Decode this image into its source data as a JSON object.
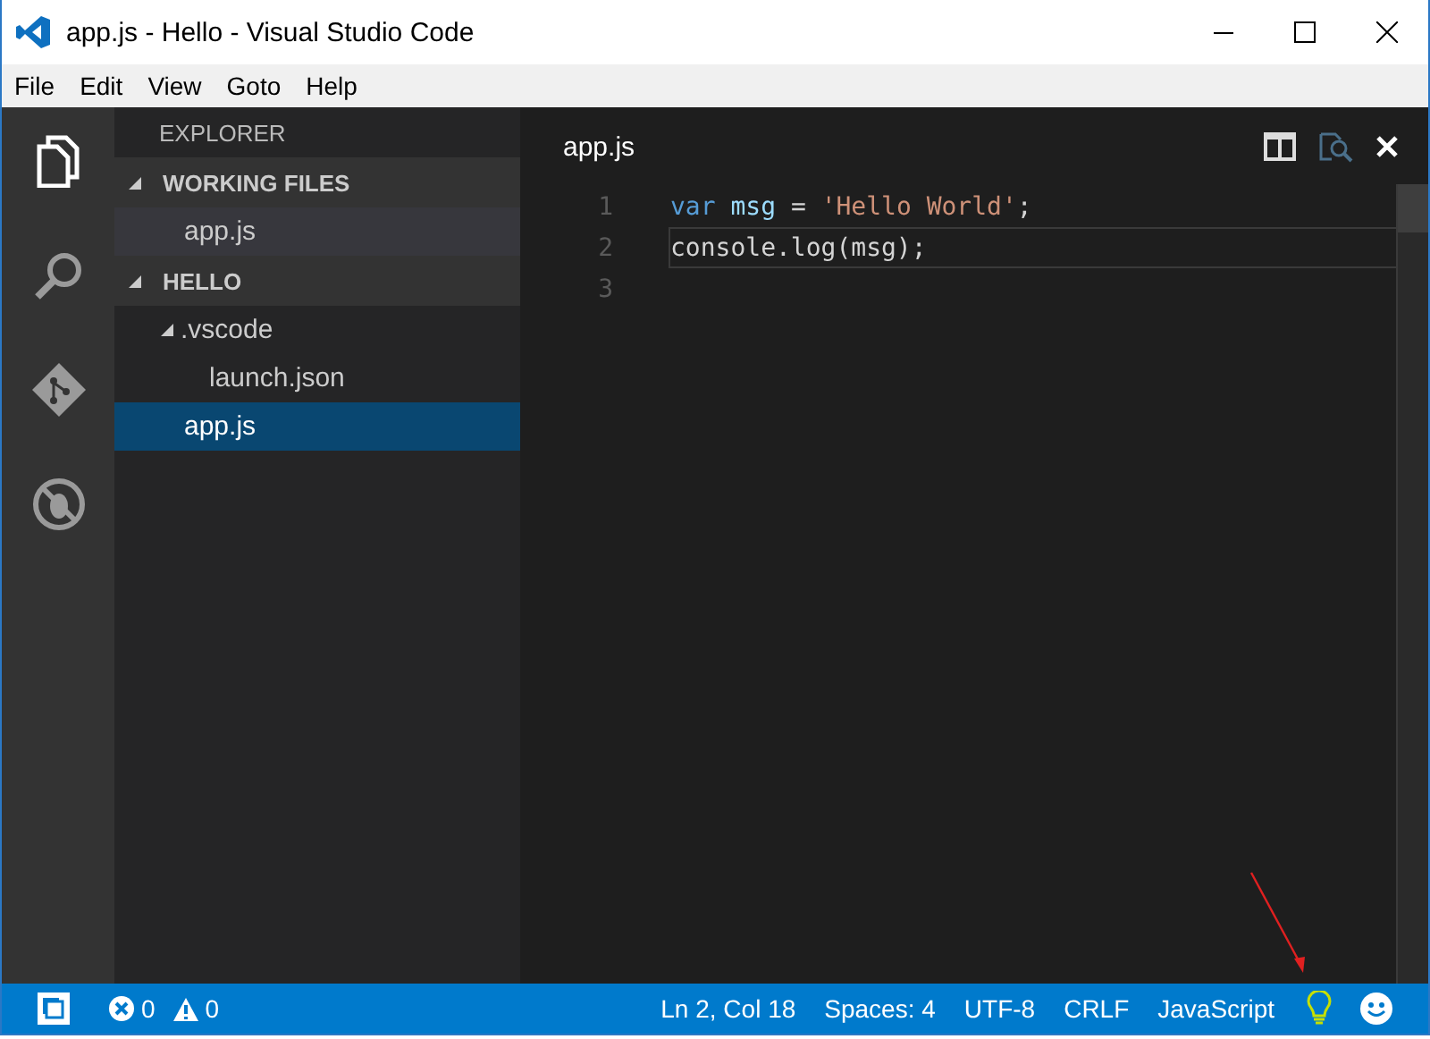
{
  "window": {
    "title": "app.js - Hello - Visual Studio Code"
  },
  "menu": [
    "File",
    "Edit",
    "View",
    "Goto",
    "Help"
  ],
  "activity_bar": [
    {
      "kind": "files",
      "selected": true
    },
    {
      "kind": "search",
      "selected": false
    },
    {
      "kind": "git",
      "selected": false
    },
    {
      "kind": "debug",
      "selected": false
    }
  ],
  "sidebar": {
    "title": "EXPLORER",
    "sections": [
      {
        "title": "WORKING FILES",
        "expanded": true,
        "focused": false,
        "items": [
          {
            "label": "app.js",
            "selected": true
          }
        ]
      },
      {
        "title": "HELLO",
        "expanded": true,
        "focused": true,
        "items": [
          {
            "label": ".vscode",
            "selected": false,
            "expanded": true,
            "children": [
              {
                "label": "launch.json",
                "selected": false
              }
            ]
          },
          {
            "label": "app.js",
            "selected": true
          }
        ]
      }
    ]
  },
  "editor": {
    "tab": "app.js",
    "lines": [
      {
        "number": "1",
        "current": false,
        "tokens": [
          {
            "kind": "keyword",
            "text": "var"
          },
          {
            "kind": "variable",
            "text": " msg"
          },
          {
            "kind": "plain",
            "text": " = "
          },
          {
            "kind": "string",
            "text": "'Hello World'"
          },
          {
            "kind": "plain",
            "text": ";"
          }
        ]
      },
      {
        "number": "2",
        "current": true,
        "tokens": [
          {
            "kind": "plain",
            "text": "console.log(msg);"
          }
        ]
      },
      {
        "number": "3"
      }
    ]
  },
  "status_bar": {
    "errors": "0",
    "warnings": "0",
    "items": [
      "Ln 2, Col 18",
      "Spaces: 4",
      "UTF-8",
      "CRLF",
      "JavaScript"
    ]
  }
}
